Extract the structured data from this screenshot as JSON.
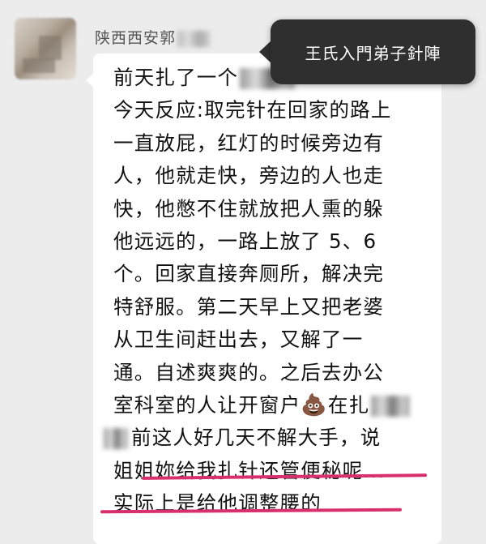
{
  "sender": {
    "name": "陕西西安郭"
  },
  "tooltip": {
    "text": "王氏入門弟子針陣"
  },
  "message": {
    "lines": [
      "前天扎了一个",
      "今天反应:取完针在回家的路上",
      "一直放屁，红灯的时候旁边有",
      "人，他就走快，旁边的人也走",
      "快，他憋不住就放把人熏的躲",
      "他远远的，一路上放了 5、6",
      "个。回家直接奔厕所，解决完",
      "特舒服。第二天早上又把老婆",
      "从卫生间赶出去，又解了一",
      "通。自述爽爽的。之后去办公",
      "室科室的人让开窗户",
      "在扎",
      "前这人好几天不解大手，说",
      "姐姐妳给我扎针还管便秘呢...",
      "实际上是给他调整腰的"
    ],
    "emoji": "💩"
  },
  "colors": {
    "underline": "#d8306e",
    "tooltip_bg": "#2f2f2f"
  }
}
